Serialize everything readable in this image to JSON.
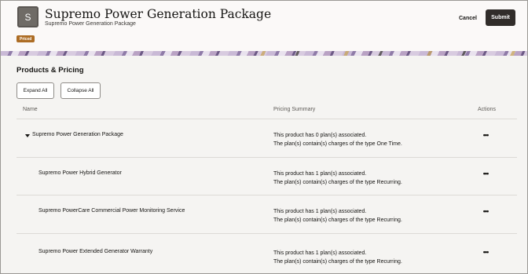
{
  "header": {
    "avatar_letter": "S",
    "title": "Supremo Power Generation Package",
    "subtitle": "Supremo Power Generation Package",
    "status_badge": "Priced",
    "cancel_label": "Cancel",
    "submit_label": "Submit"
  },
  "section": {
    "title": "Products & Pricing",
    "expand_all_label": "Expand All",
    "collapse_all_label": "Collapse All"
  },
  "table": {
    "columns": [
      "Name",
      "Pricing Summary",
      "Actions"
    ],
    "rows": [
      {
        "name": "Supremo Power Generation Package",
        "summary_line1": "This product has 0 plan(s) associated.",
        "summary_line2": "The plan(s) contain(s) charges of the type One Time.",
        "actions_icon": "more-horizontal-icon",
        "expanded": true
      },
      {
        "name": "Supremo Power Hybrid Generator",
        "summary_line1": "This product has 1 plan(s) associated.",
        "summary_line2": "The plan(s) contain(s) charges of the type Recurring.",
        "actions_icon": "more-horizontal-icon"
      },
      {
        "name": "Supremo PowerCare Commercial Power Monitoring Service",
        "summary_line1": "This product has 1 plan(s) associated.",
        "summary_line2": "The plan(s) contain(s) charges of the type Recurring.",
        "actions_icon": "more-horizontal-icon"
      },
      {
        "name": "Supremo Power Extended Generator Warranty",
        "summary_line1": "This product has 1 plan(s) associated.",
        "summary_line2": "The plan(s) contain(s) charges of the type Recurring.",
        "actions_icon": "more-horizontal-icon"
      }
    ],
    "actions_glyph": "•••"
  },
  "colors": {
    "submit_bg": "#312d2a",
    "badge_bg": "#ad6d25",
    "content_bg": "#f5f4f2"
  }
}
